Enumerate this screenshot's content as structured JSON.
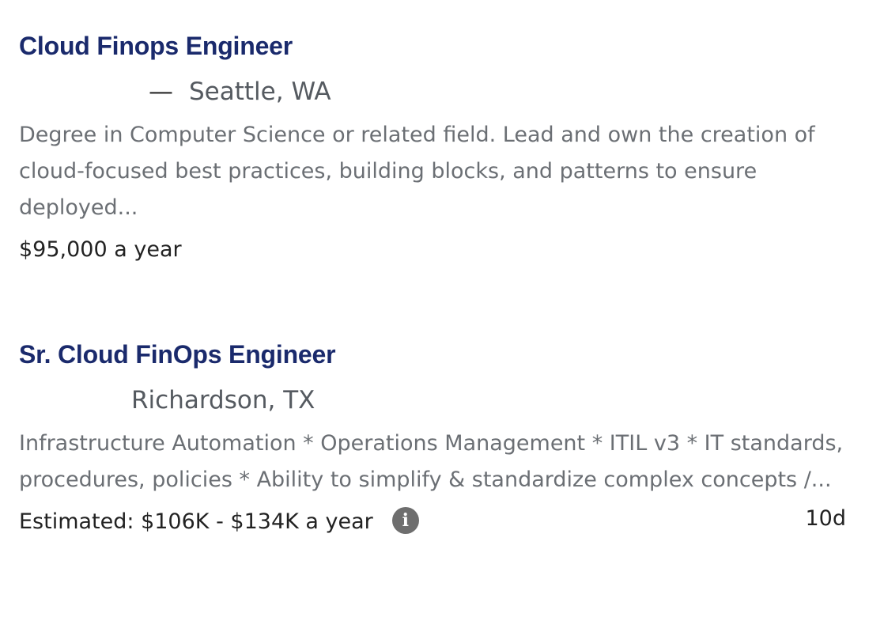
{
  "jobs": [
    {
      "title": "Cloud Finops Engineer",
      "dash": "—",
      "location": "Seattle, WA",
      "snippet": "Degree in Computer Science or related field. Lead and own the creation of cloud-focused best practices, building blocks, and patterns to ensure deployed...",
      "salary": "$95,000 a year"
    },
    {
      "title": "Sr. Cloud FinOps Engineer",
      "location": "Richardson, TX",
      "snippet": "Infrastructure Automation * Operations Management * ITIL v3 * IT standards, procedures, policies * Ability to simplify & standardize complex concepts /...",
      "salary": "Estimated: $106K - $134K a year",
      "info_icon": "info-icon",
      "info_glyph": "i",
      "age": "10d"
    }
  ]
}
